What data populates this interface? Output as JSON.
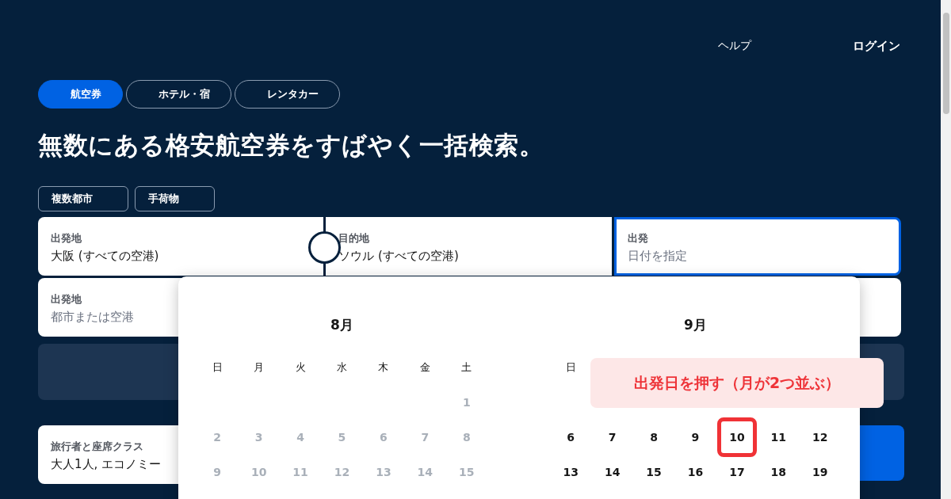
{
  "header": {
    "links": [
      {
        "label": "ヘルプ",
        "kind": "plain"
      },
      {
        "label": "ログイン",
        "kind": "strong"
      }
    ]
  },
  "tabs": [
    {
      "label": "航空券",
      "selected": true
    },
    {
      "label": "ホテル・宿",
      "selected": false
    },
    {
      "label": "レンタカー",
      "selected": false
    }
  ],
  "headline": "無数にある格安航空券をすばやく一括検索。",
  "options": [
    "複数都市",
    "手荷物"
  ],
  "search_fields": [
    {
      "label": "出発地",
      "value": "大阪 (すべての空港)",
      "focused": false
    },
    {
      "label": "目的地",
      "value": "ソウル (すべての空港)",
      "focused": false
    },
    {
      "label": "出発",
      "placeholder": "日付を指定",
      "focused": true
    }
  ],
  "second_origin": {
    "label": "出発地",
    "placeholder": "都市または空港"
  },
  "travelers": {
    "label": "旅行者と座席クラス",
    "value": "大人1人, エコノミー"
  },
  "calendar": {
    "months": [
      {
        "title": "8月",
        "disabled": true,
        "weekdays": [
          "日",
          "月",
          "火",
          "水",
          "木",
          "金",
          "土"
        ],
        "weeks": [
          [
            {
              "day": "1",
              "marked": false
            }
          ],
          [
            {
              "day": "2",
              "marked": false
            },
            {
              "day": "3",
              "marked": false
            },
            {
              "day": "4",
              "marked": false
            },
            {
              "day": "5",
              "marked": false
            },
            {
              "day": "6",
              "marked": false
            },
            {
              "day": "7",
              "marked": false
            },
            {
              "day": "8",
              "marked": false
            }
          ],
          [
            {
              "day": "9",
              "marked": false
            },
            {
              "day": "10",
              "marked": false
            },
            {
              "day": "11",
              "marked": false
            },
            {
              "day": "12",
              "marked": false
            },
            {
              "day": "13",
              "marked": false
            },
            {
              "day": "14",
              "marked": false
            },
            {
              "day": "15",
              "marked": false
            }
          ]
        ]
      },
      {
        "title": "9月",
        "disabled": false,
        "first_week_hidden": true,
        "weekdays": [
          "日"
        ],
        "weeks": [
          [
            {
              "day": "6",
              "marked": false
            },
            {
              "day": "7",
              "marked": false
            },
            {
              "day": "8",
              "marked": false
            },
            {
              "day": "9",
              "marked": false
            },
            {
              "day": "10",
              "marked": true
            },
            {
              "day": "11",
              "marked": false
            },
            {
              "day": "12",
              "marked": false
            }
          ],
          [
            {
              "day": "13",
              "marked": false
            },
            {
              "day": "14",
              "marked": false
            },
            {
              "day": "15",
              "marked": false
            },
            {
              "day": "16",
              "marked": false
            },
            {
              "day": "17",
              "marked": false
            },
            {
              "day": "18",
              "marked": false
            },
            {
              "day": "19",
              "marked": false
            }
          ]
        ]
      }
    ]
  },
  "callout": "出発日を押す（月が2つ並ぶ）"
}
